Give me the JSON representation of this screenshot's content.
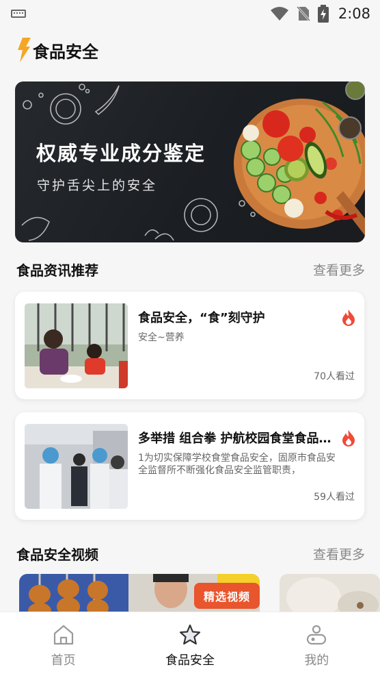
{
  "status": {
    "time": "2:08"
  },
  "header": {
    "title": "食品安全"
  },
  "banner": {
    "title": "权威专业成分鉴定",
    "subtitle": "守护舌尖上的安全"
  },
  "news_section": {
    "title": "食品资讯推荐",
    "more": "查看更多"
  },
  "news": [
    {
      "title": "食品安全，“食”刻守护",
      "desc": "安全~营养",
      "views": "70人看过"
    },
    {
      "title": "多举措 组合拳 护航校园食堂食品安全",
      "desc": "1为切实保障学校食堂食品安全，固原市食品安全监督所不断强化食品安全监管职责，",
      "views": "59人看过"
    }
  ],
  "video_section": {
    "title": "食品安全视频",
    "more": "查看更多",
    "badge": "精选视频"
  },
  "nav": [
    {
      "label": "首页",
      "icon": "home-icon"
    },
    {
      "label": "食品安全",
      "icon": "star-icon"
    },
    {
      "label": "我的",
      "icon": "profile-icon"
    }
  ],
  "colors": {
    "accent": "#f5a623",
    "badge": "#e9552d",
    "fire": "#f04a3a"
  }
}
